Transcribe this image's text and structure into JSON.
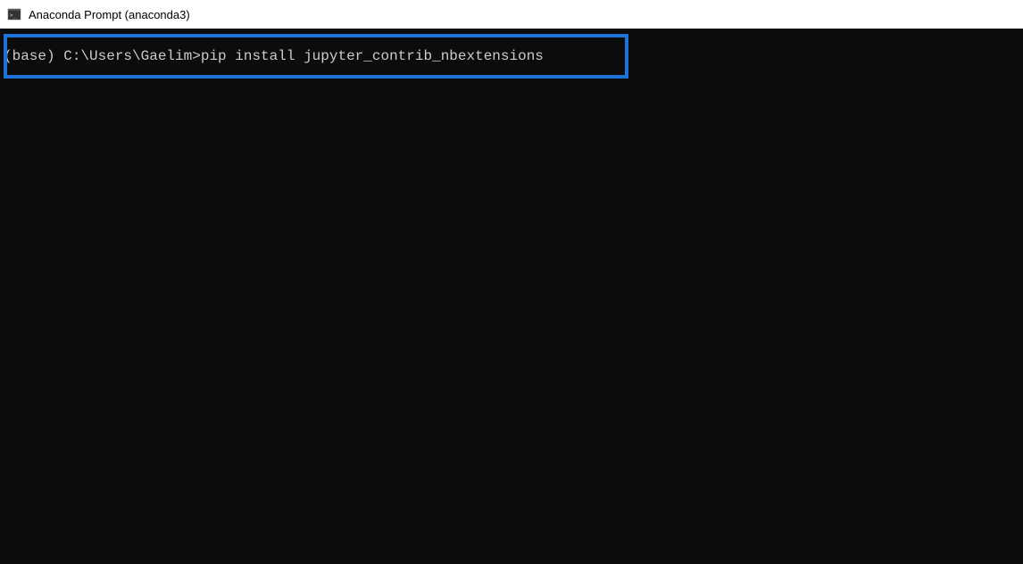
{
  "window": {
    "title": "Anaconda Prompt (anaconda3)"
  },
  "terminal": {
    "prompt": "(base) C:\\Users\\Gaelim>",
    "command": "pip install jupyter_contrib_nbextensions"
  },
  "colors": {
    "highlight_border": "#1e73d8",
    "terminal_bg": "#0c0c0c",
    "terminal_fg": "#cccccc"
  }
}
